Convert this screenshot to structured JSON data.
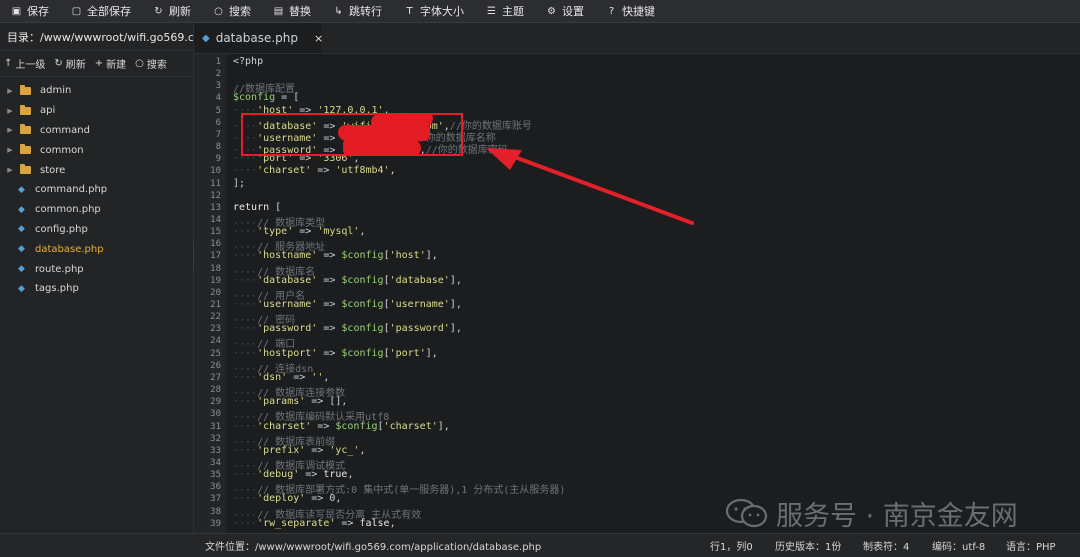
{
  "toolbar": {
    "items": [
      {
        "label": "保存",
        "icon": "save-icon"
      },
      {
        "label": "全部保存",
        "icon": "save-all-icon"
      },
      {
        "label": "刷新",
        "icon": "refresh-icon"
      },
      {
        "label": "搜索",
        "icon": "search-icon"
      },
      {
        "label": "替换",
        "icon": "replace-icon"
      },
      {
        "label": "跳转行",
        "icon": "goto-line-icon"
      },
      {
        "label": "字体大小",
        "icon": "font-size-icon"
      },
      {
        "label": "主题",
        "icon": "theme-icon"
      },
      {
        "label": "设置",
        "icon": "settings-icon"
      },
      {
        "label": "快捷键",
        "icon": "help-icon"
      }
    ]
  },
  "sidebar": {
    "dir_label": "目录：/www/wwwroot/wifi.go569.c...",
    "actions": [
      {
        "label": "上一级",
        "icon": "up-arrow-icon"
      },
      {
        "label": "刷新",
        "icon": "refresh-icon"
      },
      {
        "label": "新建",
        "icon": "plus-icon"
      },
      {
        "label": "搜索",
        "icon": "search-icon"
      }
    ],
    "tree": [
      {
        "label": "admin",
        "type": "folder"
      },
      {
        "label": "api",
        "type": "folder"
      },
      {
        "label": "command",
        "type": "folder"
      },
      {
        "label": "common",
        "type": "folder"
      },
      {
        "label": "store",
        "type": "folder"
      },
      {
        "label": "command.php",
        "type": "php"
      },
      {
        "label": "common.php",
        "type": "php"
      },
      {
        "label": "config.php",
        "type": "php"
      },
      {
        "label": "database.php",
        "type": "php",
        "active": true
      },
      {
        "label": "route.php",
        "type": "php"
      },
      {
        "label": "tags.php",
        "type": "php"
      }
    ]
  },
  "tab": {
    "label": "database.php",
    "close": "×"
  },
  "code": {
    "lines": [
      "<?php",
      "",
      "//数据库配置",
      "$config = [",
      "    'host' => '127.0.0.1',",
      "    'database' => 'wifi.      .com',//你的数据库账号",
      "    'username' => '        m',//你的数据库名称",
      "    'password' => '          m',//你的数据库密码",
      "    'port' => '3306',",
      "    'charset' => 'utf8mb4',",
      "];",
      "",
      "return [",
      "    // 数据库类型",
      "    'type' => 'mysql',",
      "    // 服务器地址",
      "    'hostname' => $config['host'],",
      "    // 数据库名",
      "    'database' => $config['database'],",
      "    // 用户名",
      "    'username' => $config['username'],",
      "    // 密码",
      "    'password' => $config['password'],",
      "    // 端口",
      "    'hostport' => $config['port'],",
      "    // 连接dsn",
      "    'dsn' => '',",
      "    // 数据库连接参数",
      "    'params' => [],",
      "    // 数据库编码默认采用utf8",
      "    'charset' => $config['charset'],",
      "    // 数据库表前缀",
      "    'prefix' => 'yc_',",
      "    // 数据库调试模式",
      "    'debug' => true,",
      "    // 数据库部署方式:0 集中式(单一服务器),1 分布式(主从服务器)",
      "    'deploy' => 0,",
      "    // 数据库读写是否分离 主从式有效",
      "    'rw_separate' => false,"
    ]
  },
  "watermark": {
    "text": "服务号 · 南京金友网"
  },
  "status": {
    "path": "文件位置：/www/wwwroot/wifi.go569.com/application/database.php",
    "cursor": "行1，列0",
    "history": "历史版本：1份",
    "tab": "制表符：4",
    "encoding": "编码：utf-8",
    "language": "语言：PHP"
  },
  "colors": {
    "annotation": "#e3202a",
    "active_file": "#e8b23a"
  }
}
